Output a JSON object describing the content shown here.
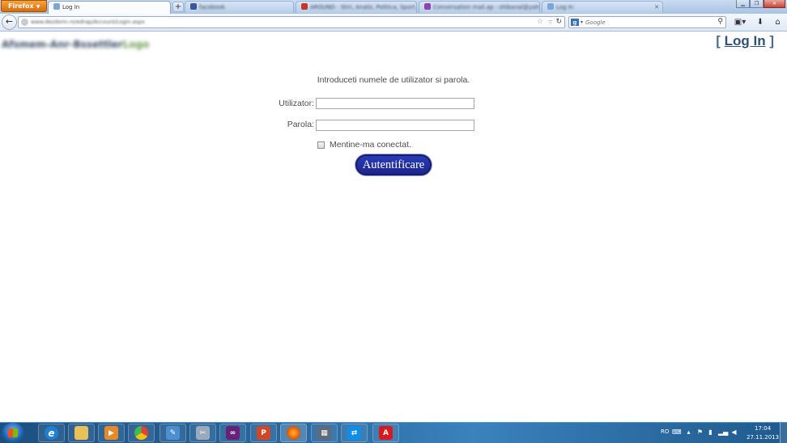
{
  "browser": {
    "menu_label": "Firefox",
    "tabs": [
      {
        "title": "Log In",
        "favicon_color": "#7aa7d8",
        "active": true,
        "blurred": false
      },
      {
        "title": "facebook",
        "favicon_color": "#3b5998",
        "active": false,
        "blurred": true
      },
      {
        "title": "AROUND · Stiri, Analiz, Politica, Sport, Sh...",
        "favicon_color": "#c0392b",
        "active": false,
        "blurred": true
      },
      {
        "title": "Conversation mail.ap - shibanal@yahoo.co...",
        "favicon_color": "#8e44ad",
        "active": false,
        "blurred": true
      },
      {
        "title": "Log In",
        "favicon_color": "#7aa7d8",
        "active": false,
        "blurred": true
      }
    ],
    "new_tab_symbol": "+",
    "url_text": "www.dezdorin.ro/edrap/Account/Login.aspx",
    "search_engine_letter": "g",
    "search_placeholder": "Google"
  },
  "page": {
    "logo_part1": "Afsmem-Anr-Bssettler",
    "logo_part2": "Logo",
    "login_link": "Log In",
    "login_bracket_open": "[",
    "login_bracket_close": "]",
    "instructions": "Introduceti numele de utilizator si parola.",
    "username_label": "Utilizator:",
    "username_value": "",
    "password_label": "Parola:",
    "password_value": "",
    "remember_label": "Mentine-ma conectat.",
    "remember_checked": false,
    "submit_label": "Autentificare"
  },
  "taskbar": {
    "apps": [
      {
        "name": "internet-explorer",
        "glyph": "e",
        "color": "#1e7fd6"
      },
      {
        "name": "file-explorer",
        "glyph": "",
        "color": "#e8c15a"
      },
      {
        "name": "media-player",
        "glyph": "▶",
        "color": "#e58a2c"
      },
      {
        "name": "chrome",
        "glyph": "",
        "color": "#e34133"
      },
      {
        "name": "paint",
        "glyph": "✎",
        "color": "#4c8fd1"
      },
      {
        "name": "tools",
        "glyph": "✂",
        "color": "#9aa9bb"
      },
      {
        "name": "visual-studio",
        "glyph": "∞",
        "color": "#68217a"
      },
      {
        "name": "powerpoint",
        "glyph": "P",
        "color": "#d24726"
      },
      {
        "name": "firefox",
        "glyph": "",
        "color": "#e66000"
      },
      {
        "name": "calculator",
        "glyph": "▦",
        "color": "#5d6b7a"
      },
      {
        "name": "teamviewer",
        "glyph": "⇄",
        "color": "#0e8ee9"
      },
      {
        "name": "acrobat",
        "glyph": "A",
        "color": "#d71920"
      }
    ],
    "language": "RO",
    "time": "17:04",
    "date": "27.11.2013"
  }
}
